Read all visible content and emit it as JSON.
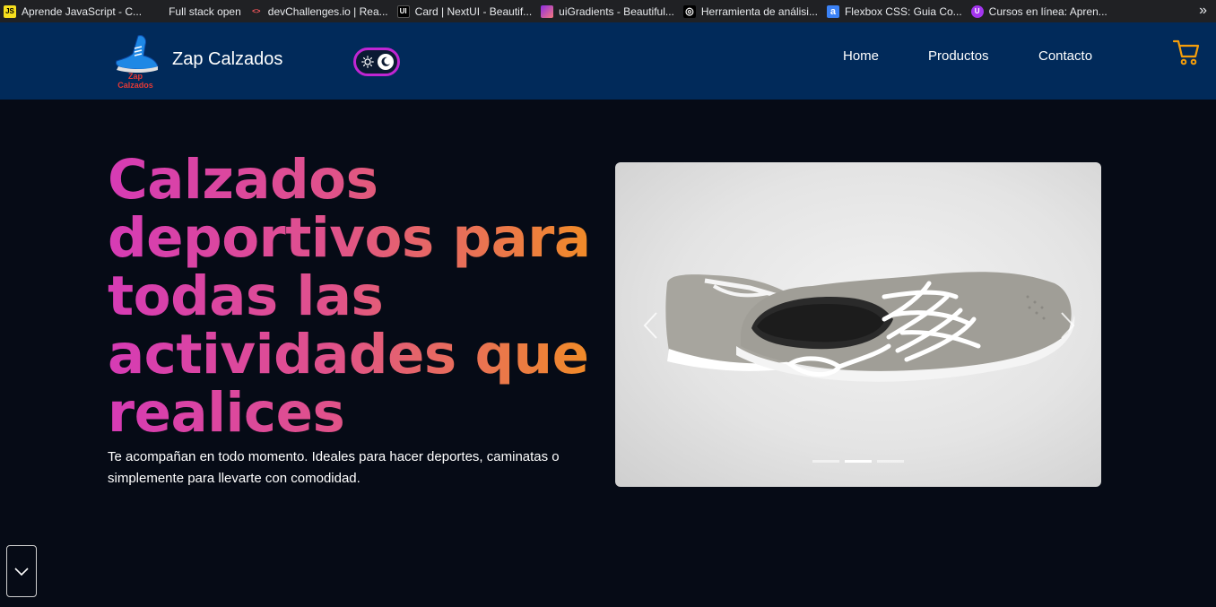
{
  "bookmarks": [
    {
      "label": "Aprende JavaScript - C...",
      "icon": "js-icon",
      "icon_text": "JS",
      "icon_bg": "#f7df1e",
      "icon_fg": "#000000"
    },
    {
      "label": "Full stack open",
      "icon": "",
      "icon_text": "",
      "icon_bg": "",
      "icon_fg": ""
    },
    {
      "label": "devChallenges.io | Rea...",
      "icon": "devchallenges-icon",
      "icon_text": "<>",
      "icon_bg": "#202124",
      "icon_fg": "#ff5a5f"
    },
    {
      "label": "Card | NextUI - Beautif...",
      "icon": "nextui-icon",
      "icon_text": "UI",
      "icon_bg": "#000000",
      "icon_fg": "#ffffff"
    },
    {
      "label": "uiGradients - Beautiful...",
      "icon": "uigradients-icon",
      "icon_text": "",
      "icon_bg": "#8e2de2",
      "icon_fg": "#ffffff"
    },
    {
      "label": "Herramienta de análisi...",
      "icon": "analysis-tool-icon",
      "icon_text": "◎",
      "icon_bg": "#000000",
      "icon_fg": "#ffffff"
    },
    {
      "label": "Flexbox CSS: Guia Co...",
      "icon": "flexbox-guide-icon",
      "icon_text": "a",
      "icon_bg": "#3b82f6",
      "icon_fg": "#ffffff"
    },
    {
      "label": "Cursos en línea: Apren...",
      "icon": "udemy-icon",
      "icon_text": "U",
      "icon_bg": "#a435f0",
      "icon_fg": "#ffffff"
    }
  ],
  "bookmarks_more": "»",
  "brand": {
    "name": "Zap Calzados",
    "logo": "sneaker-logo-icon",
    "logo_text_top": "Zap",
    "logo_text_bottom": "Calzados"
  },
  "theme_toggle": {
    "sun_icon": "sun-icon",
    "moon_icon": "moon-icon",
    "border_color": "#c026d3"
  },
  "nav": {
    "links": [
      "Home",
      "Productos",
      "Contacto"
    ],
    "cart_icon": "cart-icon",
    "cart_color": "#f59e0b"
  },
  "hero": {
    "title": "Calzados deportivos para todas las actividades que realices",
    "description": "Te acompañan en todo momento. Ideales para hacer deportes, caminatas o simplemente para llevarte con comodidad.",
    "gradient_colors": [
      "#d63bb5",
      "#e0528a",
      "#f08a2a"
    ]
  },
  "carousel": {
    "image": "gray-sneaker-image",
    "prev_icon": "chevron-left-icon",
    "next_icon": "chevron-right-icon",
    "slides": 3,
    "active_slide": 2
  },
  "scroll_button": {
    "icon": "chevron-down-icon"
  },
  "colors": {
    "navbar_bg": "#012a5a",
    "page_bg": "#060b16"
  }
}
